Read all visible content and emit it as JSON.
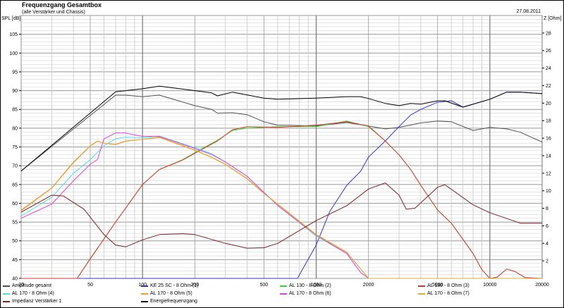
{
  "header": {
    "title": "Frequenzgang Gesamtbox",
    "subtitle": "(alle Verstärker und Chassis)",
    "date": "27.08.2011"
  },
  "chart_data": {
    "type": "line",
    "title": "Frequenzgang Gesamtbox",
    "ylabel": "SPL [dB]",
    "y2label": "Z [Ohm]",
    "xscale": "log",
    "xlim": [
      20,
      20000
    ],
    "ylim": [
      40,
      110
    ],
    "y2lim": [
      0,
      30
    ],
    "grid": true,
    "legend_position": "bottom",
    "x_ticks": [
      "20",
      "50",
      "100",
      "200",
      "500",
      "1000",
      "2000",
      "5000",
      "10000",
      "20000"
    ],
    "y_ticks": [
      "40",
      "45",
      "50",
      "55",
      "60",
      "65",
      "70",
      "75",
      "80",
      "85",
      "90",
      "95",
      "100",
      "105"
    ],
    "y2_ticks": [
      "2",
      "4",
      "6",
      "8",
      "10",
      "12",
      "14",
      "16",
      "18",
      "20",
      "22",
      "24",
      "26",
      "28"
    ],
    "series": [
      {
        "name": "Amplitude gesamt",
        "color": "#505050",
        "axis": "left",
        "points": [
          [
            20,
            68.6
          ],
          [
            70,
            88.8
          ],
          [
            80,
            88.8
          ],
          [
            100,
            88.4
          ],
          [
            125,
            88.8
          ],
          [
            200,
            86
          ],
          [
            250,
            85
          ],
          [
            270,
            84
          ],
          [
            330,
            84.1
          ],
          [
            400,
            83.6
          ],
          [
            500,
            81.7
          ],
          [
            600,
            80.8
          ],
          [
            1000,
            80.6
          ],
          [
            1500,
            81.5
          ],
          [
            2000,
            80.6
          ],
          [
            2500,
            79.8
          ],
          [
            3000,
            80.2
          ],
          [
            4000,
            81.4
          ],
          [
            5000,
            81.9
          ],
          [
            6000,
            81.7
          ],
          [
            8000,
            79.4
          ],
          [
            10000,
            80.2
          ],
          [
            12500,
            79.8
          ],
          [
            15000,
            78.9
          ],
          [
            20000,
            76.3
          ]
        ]
      },
      {
        "name": "KE 25 SC - 8 Ohm   (1)",
        "color": "#3333cc",
        "axis": "left",
        "points": [
          [
            20,
            40
          ],
          [
            780,
            40
          ],
          [
            1000,
            48.9
          ],
          [
            1200,
            57.9
          ],
          [
            1500,
            64.8
          ],
          [
            1800,
            68.5
          ],
          [
            2000,
            72.3
          ],
          [
            2500,
            76.6
          ],
          [
            3000,
            80.4
          ],
          [
            3500,
            83.5
          ],
          [
            4000,
            85
          ],
          [
            5000,
            86.9
          ],
          [
            6000,
            87.3
          ],
          [
            7000,
            85.6
          ],
          [
            10000,
            87.7
          ],
          [
            12500,
            89.6
          ],
          [
            15000,
            89.6
          ],
          [
            20000,
            89.2
          ]
        ]
      },
      {
        "name": "AL 130 - 8 Ohm (2)",
        "color": "#33dd33",
        "axis": "left",
        "points": [
          [
            20,
            40
          ],
          [
            42,
            40
          ],
          [
            50,
            45.3
          ],
          [
            70,
            55
          ],
          [
            100,
            65
          ],
          [
            125,
            69
          ],
          [
            170,
            71.6
          ],
          [
            200,
            73.5
          ],
          [
            270,
            76.8
          ],
          [
            330,
            79.4
          ],
          [
            400,
            80
          ],
          [
            600,
            80.4
          ],
          [
            1000,
            80.4
          ],
          [
            1500,
            81.9
          ],
          [
            2000,
            80.4
          ],
          [
            2500,
            76.6
          ],
          [
            3000,
            72.9
          ],
          [
            3500,
            69
          ],
          [
            4000,
            64.8
          ],
          [
            5000,
            58.2
          ],
          [
            6000,
            54.7
          ],
          [
            7000,
            50.4
          ],
          [
            8000,
            46.6
          ],
          [
            9000,
            42.3
          ],
          [
            10000,
            40
          ],
          [
            11000,
            40.3
          ],
          [
            12500,
            42.5
          ],
          [
            14000,
            41.8
          ],
          [
            16000,
            40.2
          ],
          [
            20000,
            40
          ]
        ]
      },
      {
        "name": "AL 130 - 8 Ohm (3)",
        "color": "#dd3333",
        "axis": "left",
        "points": [
          [
            20,
            40
          ],
          [
            42,
            40
          ],
          [
            50,
            45.2
          ],
          [
            70,
            55
          ],
          [
            100,
            65
          ],
          [
            125,
            69
          ],
          [
            170,
            71.5
          ],
          [
            200,
            73.3
          ],
          [
            270,
            76.6
          ],
          [
            330,
            79.6
          ],
          [
            400,
            80.4
          ],
          [
            600,
            80.2
          ],
          [
            1000,
            80.8
          ],
          [
            1500,
            81.7
          ],
          [
            2000,
            80.6
          ],
          [
            2500,
            76.6
          ],
          [
            3000,
            72.9
          ],
          [
            3500,
            69
          ],
          [
            4000,
            64.8
          ],
          [
            5000,
            58.2
          ],
          [
            6000,
            54.7
          ],
          [
            7000,
            50.4
          ],
          [
            8000,
            46.6
          ],
          [
            9000,
            42.3
          ],
          [
            10000,
            40
          ],
          [
            11000,
            40.3
          ],
          [
            12500,
            42.5
          ],
          [
            14000,
            41.8
          ],
          [
            16000,
            40.2
          ],
          [
            20000,
            40
          ]
        ]
      },
      {
        "name": "AL 170 - 8 Ohm (4)",
        "color": "#55dddd",
        "axis": "left",
        "points": [
          [
            20,
            56.6
          ],
          [
            30,
            61.6
          ],
          [
            40,
            68
          ],
          [
            50,
            71.6
          ],
          [
            60,
            75.3
          ],
          [
            70,
            77.2
          ],
          [
            80,
            77.6
          ],
          [
            100,
            77.4
          ],
          [
            125,
            77.9
          ],
          [
            200,
            74.8
          ],
          [
            250,
            73.2
          ],
          [
            300,
            71
          ],
          [
            400,
            67.2
          ],
          [
            500,
            62.9
          ],
          [
            600,
            59.4
          ],
          [
            1000,
            51.3
          ],
          [
            1500,
            46.6
          ],
          [
            1800,
            41.6
          ],
          [
            2000,
            40
          ],
          [
            20000,
            40
          ]
        ]
      },
      {
        "name": "AL 170 - 8 Ohm (5)",
        "color": "#ee9933",
        "axis": "left",
        "points": [
          [
            20,
            58.2
          ],
          [
            30,
            64.1
          ],
          [
            40,
            71
          ],
          [
            50,
            75.3
          ],
          [
            55,
            76.6
          ],
          [
            60,
            76
          ],
          [
            70,
            75.7
          ],
          [
            80,
            76.6
          ],
          [
            100,
            77
          ],
          [
            125,
            77.6
          ],
          [
            200,
            74.2
          ],
          [
            250,
            72.3
          ],
          [
            300,
            70.4
          ],
          [
            400,
            66.6
          ],
          [
            500,
            62.7
          ],
          [
            1000,
            51.7
          ],
          [
            1500,
            47
          ],
          [
            2000,
            40
          ],
          [
            20000,
            40
          ]
        ]
      },
      {
        "name": "AL 170 - 8 Ohm (6)",
        "color": "#dd44dd",
        "axis": "left",
        "points": [
          [
            20,
            56
          ],
          [
            30,
            59.8
          ],
          [
            40,
            66
          ],
          [
            50,
            70.4
          ],
          [
            55,
            71.6
          ],
          [
            60,
            77.2
          ],
          [
            70,
            78.7
          ],
          [
            80,
            78.7
          ],
          [
            100,
            77.8
          ],
          [
            125,
            77.8
          ],
          [
            200,
            74.6
          ],
          [
            250,
            73
          ],
          [
            300,
            71
          ],
          [
            400,
            67.2
          ],
          [
            500,
            62.9
          ],
          [
            600,
            59.4
          ],
          [
            1000,
            51.5
          ],
          [
            1500,
            46.6
          ],
          [
            1800,
            41.6
          ],
          [
            2000,
            40
          ],
          [
            20000,
            40
          ]
        ]
      },
      {
        "name": "AL 170 - 8 Ohm (7)",
        "color": "#ddaa44",
        "axis": "left",
        "points": [
          [
            20,
            58
          ],
          [
            30,
            64
          ],
          [
            40,
            70.8
          ],
          [
            50,
            75.2
          ],
          [
            55,
            76.5
          ],
          [
            60,
            76
          ],
          [
            70,
            75.6
          ],
          [
            80,
            76.5
          ],
          [
            100,
            77
          ],
          [
            125,
            77.5
          ],
          [
            200,
            74.1
          ],
          [
            250,
            72.2
          ],
          [
            300,
            70.3
          ],
          [
            400,
            66.5
          ],
          [
            500,
            62.6
          ],
          [
            1000,
            51.6
          ],
          [
            1500,
            46.9
          ],
          [
            2000,
            40
          ],
          [
            20000,
            40
          ]
        ]
      },
      {
        "name": "Impedanz Verstärker 1",
        "color": "#7a2020",
        "axis": "right",
        "points": [
          [
            20,
            7.55
          ],
          [
            30,
            9.5
          ],
          [
            35,
            9.4
          ],
          [
            46,
            7.9
          ],
          [
            60,
            5
          ],
          [
            70,
            3.8
          ],
          [
            80,
            3.6
          ],
          [
            100,
            4.4
          ],
          [
            125,
            5
          ],
          [
            170,
            5.1
          ],
          [
            200,
            5
          ],
          [
            300,
            4
          ],
          [
            400,
            3.45
          ],
          [
            500,
            3.5
          ],
          [
            600,
            4
          ],
          [
            1000,
            6.6
          ],
          [
            1500,
            8.3
          ],
          [
            2000,
            10.2
          ],
          [
            2500,
            10.9
          ],
          [
            3000,
            9.5
          ],
          [
            3300,
            7.9
          ],
          [
            3700,
            8
          ],
          [
            5000,
            10.4
          ],
          [
            5500,
            10.7
          ],
          [
            8000,
            8.4
          ],
          [
            10000,
            7.5
          ],
          [
            15000,
            6.3
          ],
          [
            20000,
            6.3
          ]
        ]
      },
      {
        "name": "Energiefrequenzgang",
        "color": "#000000",
        "axis": "left",
        "points": [
          [
            20,
            68.6
          ],
          [
            70,
            89.7
          ],
          [
            80,
            90
          ],
          [
            100,
            90.5
          ],
          [
            125,
            91.2
          ],
          [
            200,
            90
          ],
          [
            250,
            89.4
          ],
          [
            270,
            88.6
          ],
          [
            330,
            89.6
          ],
          [
            500,
            88
          ],
          [
            600,
            87.7
          ],
          [
            1000,
            88
          ],
          [
            1500,
            88.4
          ],
          [
            1800,
            88.4
          ],
          [
            2000,
            87.9
          ],
          [
            2500,
            86.6
          ],
          [
            3000,
            86
          ],
          [
            3500,
            86.6
          ],
          [
            4000,
            86.4
          ],
          [
            5000,
            87.3
          ],
          [
            5500,
            87.3
          ],
          [
            7000,
            85.6
          ],
          [
            10000,
            87.7
          ],
          [
            12500,
            89.6
          ],
          [
            15000,
            89.6
          ],
          [
            20000,
            89.2
          ]
        ]
      }
    ]
  }
}
